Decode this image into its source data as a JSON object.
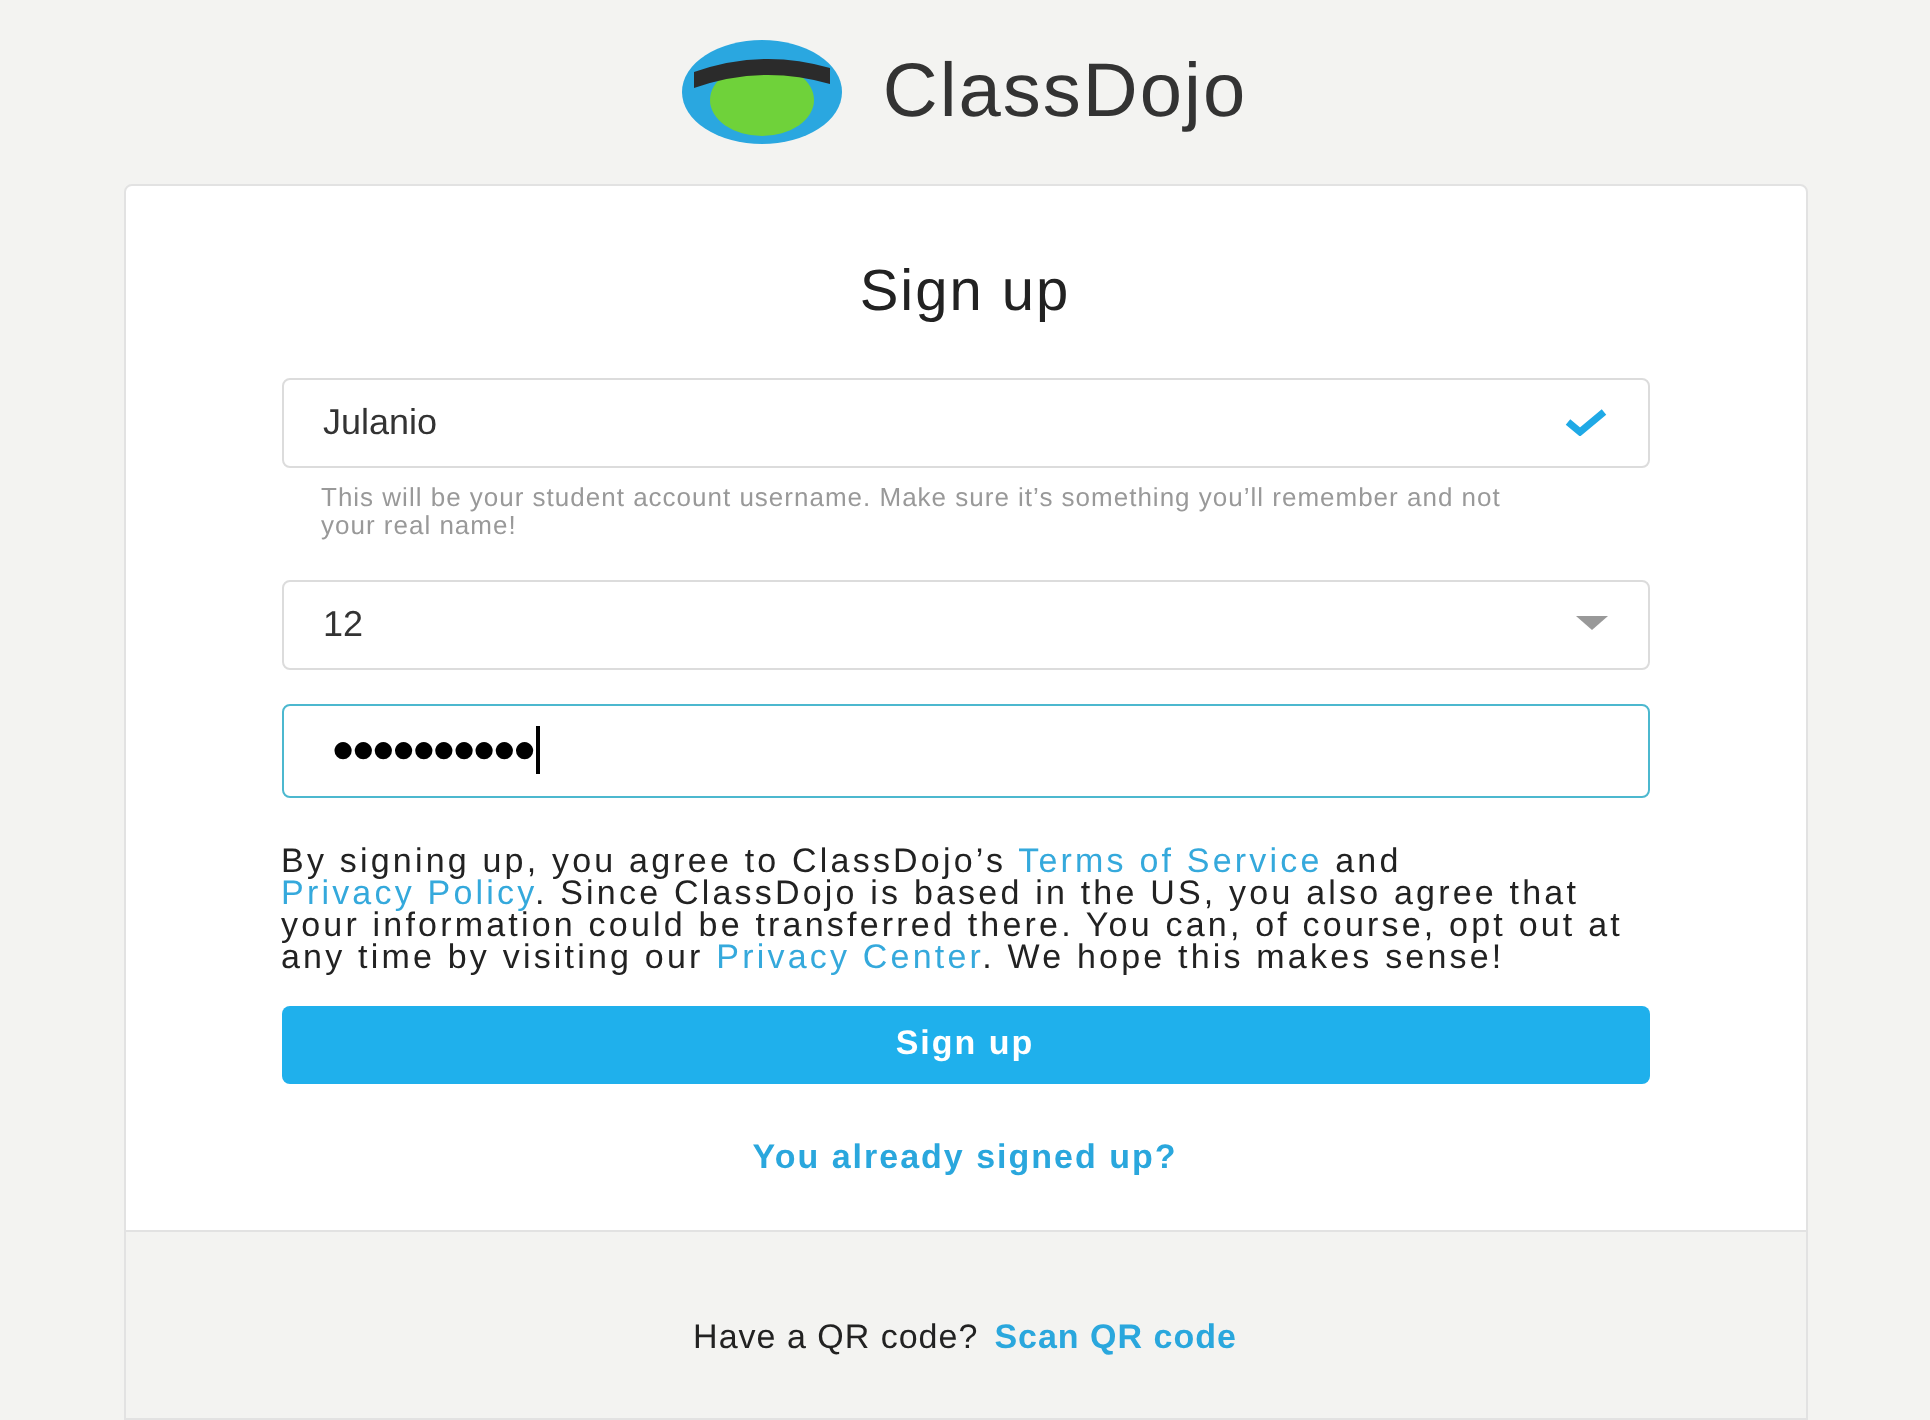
{
  "brand": {
    "name": "ClassDojo"
  },
  "form": {
    "title": "Sign up",
    "username": {
      "value": "Julanio",
      "valid": true,
      "hint": "This will be your student account username. Make sure it’s something you’ll remember and not your real name!"
    },
    "age_select": {
      "value": "12"
    },
    "password": {
      "value": "●●●●●●●●●●",
      "focused": true
    },
    "consent": [
      {
        "text": "By signing up, you agree to ClassDojo’s ",
        "link": false
      },
      {
        "text": "Terms of Service",
        "link": true
      },
      {
        "text": " and ",
        "link": false
      },
      {
        "text": "Privacy Policy",
        "link": true
      },
      {
        "text": ". Since ClassDojo is based in the US, you also agree that your information could be transferred there. You can, of course, opt out at any time by visiting our ",
        "link": false
      },
      {
        "text": "Privacy Center",
        "link": true
      },
      {
        "text": ". We hope this makes sense!",
        "link": false
      }
    ],
    "submit": "Sign up",
    "login_link": "You already signed up?"
  },
  "footer": {
    "prompt": "Have a QR code?",
    "link": "Scan QR code"
  }
}
